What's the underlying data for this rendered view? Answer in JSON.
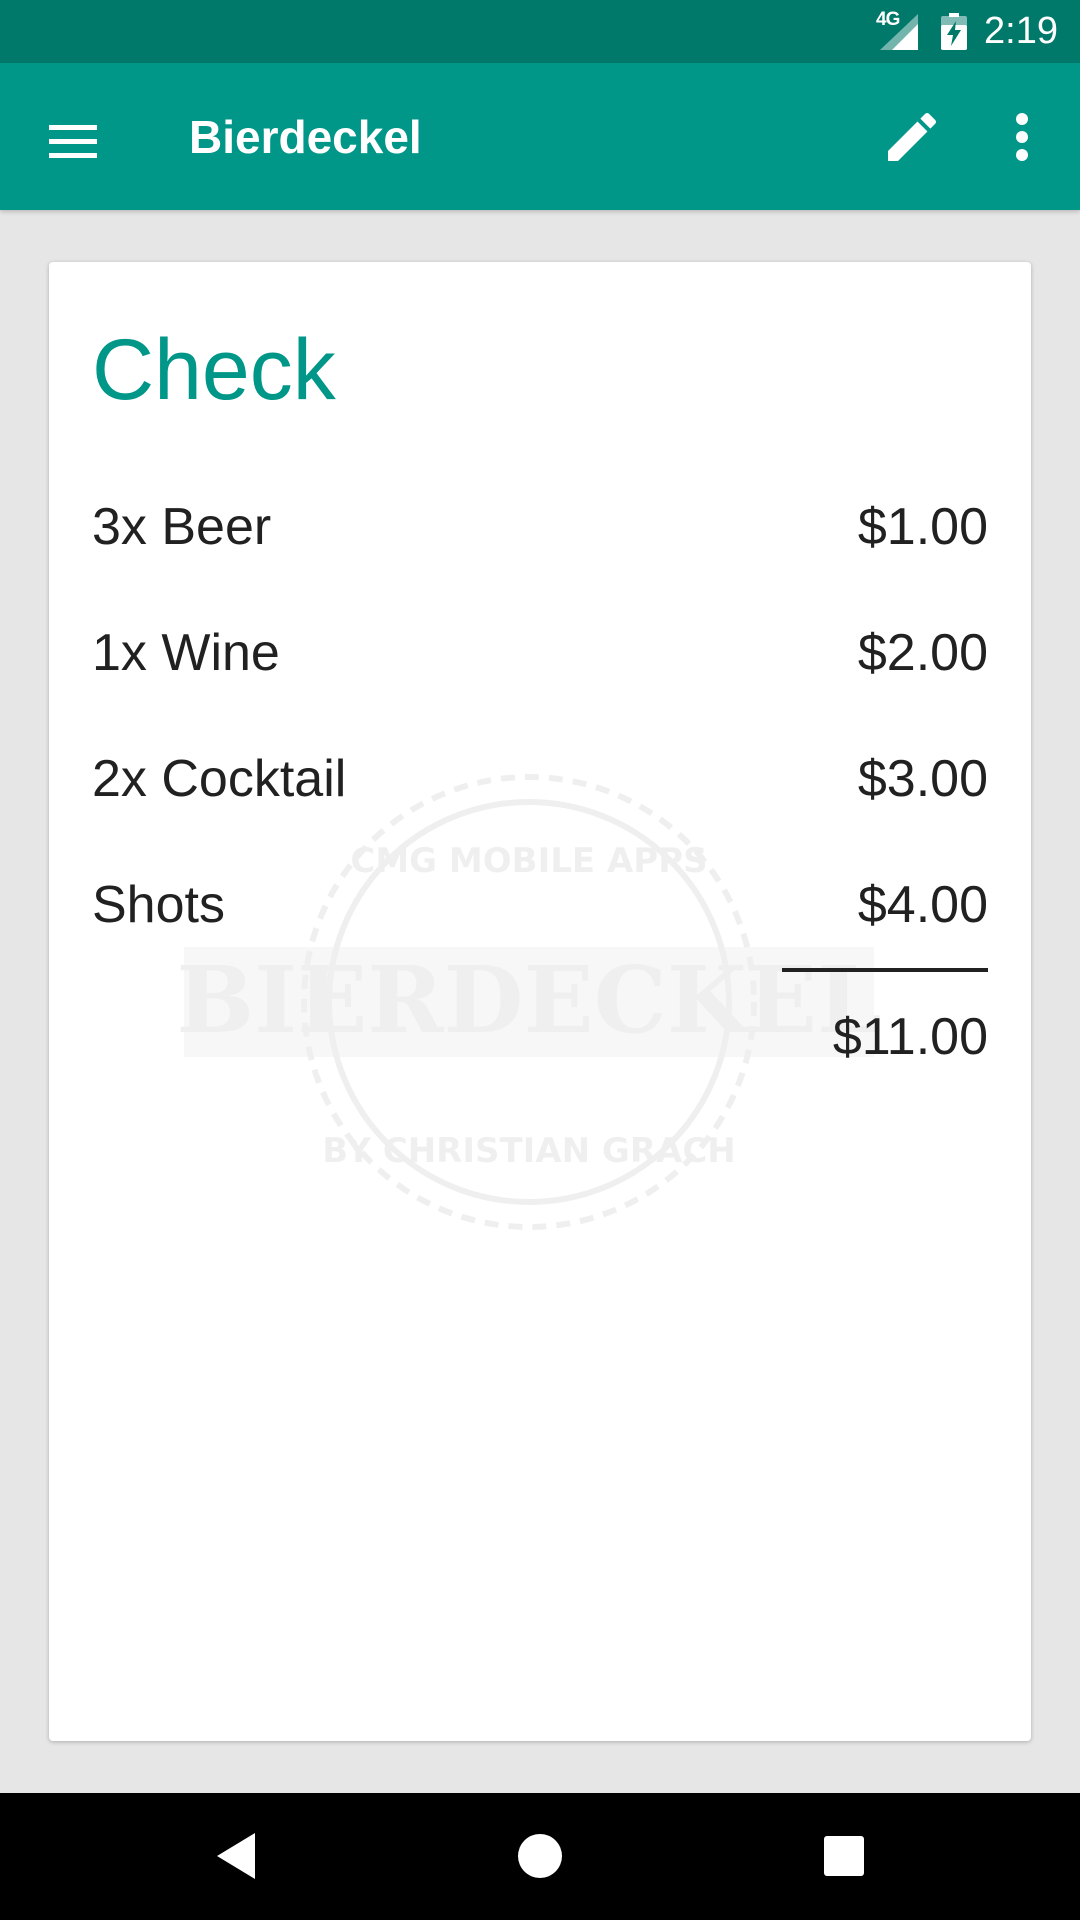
{
  "status_bar": {
    "network": "4G",
    "time": "2:19"
  },
  "app_bar": {
    "title": "Bierdeckel",
    "icons": {
      "menu": "hamburger-menu-icon",
      "edit": "pencil-icon",
      "more": "more-vert-icon"
    }
  },
  "check": {
    "title": "Check",
    "items": [
      {
        "name": "3x Beer",
        "price": "$1.00"
      },
      {
        "name": "1x Wine",
        "price": "$2.00"
      },
      {
        "name": "2x Cocktail",
        "price": "$3.00"
      },
      {
        "name": "Shots",
        "price": "$4.00"
      }
    ],
    "total": "$11.00",
    "watermark": {
      "top_text": "CMG MOBILE APPS",
      "banner_text": "BIERDECKEL",
      "bottom_text": "BY CHRISTIAN GRACH"
    }
  },
  "colors": {
    "status_bar": "#00796b",
    "primary": "#009688",
    "background": "#e6e6e6",
    "text": "#212121"
  },
  "nav_bar": {
    "icons": [
      "back-icon",
      "home-icon",
      "recents-icon"
    ]
  }
}
